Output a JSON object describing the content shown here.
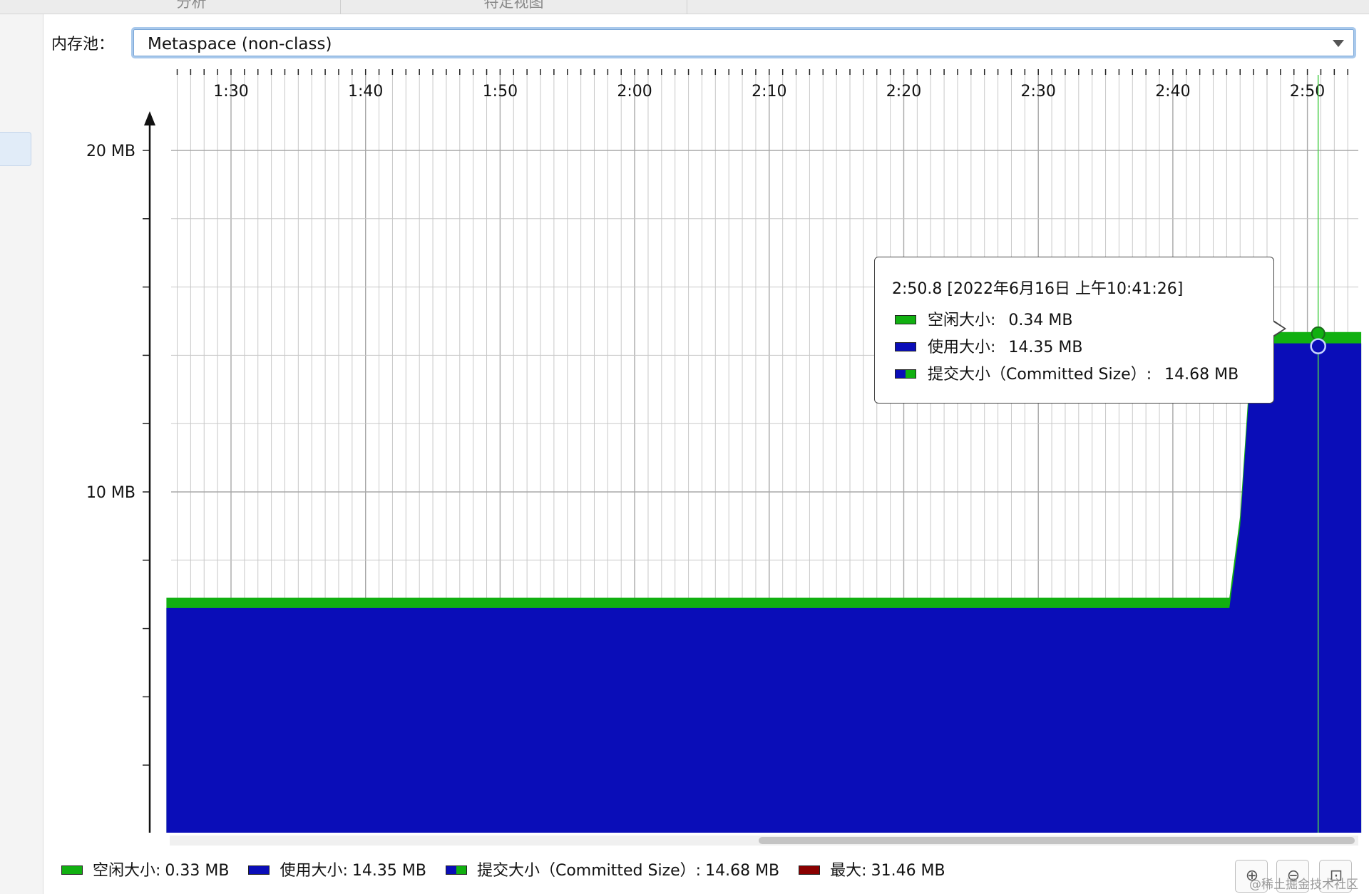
{
  "top_tabs": [
    "分析",
    "特定视图"
  ],
  "pool": {
    "label": "内存池：",
    "selected": "Metaspace (non-class)"
  },
  "colors": {
    "free": "#11b011",
    "used": "#0a0db8",
    "max": "#8a0000",
    "selection": "#a9c9ec"
  },
  "chart_data": {
    "type": "area",
    "x_ticks": [
      "1:30",
      "1:40",
      "1:50",
      "2:00",
      "2:10",
      "2:20",
      "2:30",
      "2:40",
      "2:50"
    ],
    "x_tick_minutes": [
      90,
      100,
      110,
      120,
      130,
      140,
      150,
      160,
      170
    ],
    "y_ticks": [
      "20 MB",
      "10 MB"
    ],
    "y_tick_values": [
      20,
      10
    ],
    "series": [
      {
        "name": "使用大小",
        "color": "#0a0db8",
        "points": [
          [
            85.2,
            6.6
          ],
          [
            164.2,
            6.6
          ],
          [
            165.0,
            9.0
          ],
          [
            165.6,
            12.5
          ],
          [
            166.0,
            14.1
          ],
          [
            166.6,
            14.35
          ],
          [
            170.8,
            14.35
          ],
          [
            174.0,
            14.35
          ]
        ]
      },
      {
        "name": "提交大小（Committed Size）",
        "color": "#11b011",
        "points": [
          [
            85.2,
            6.9
          ],
          [
            164.2,
            6.9
          ],
          [
            165.0,
            9.3
          ],
          [
            165.6,
            12.8
          ],
          [
            166.0,
            14.4
          ],
          [
            166.6,
            14.68
          ],
          [
            170.8,
            14.68
          ],
          [
            174.0,
            14.68
          ]
        ]
      }
    ],
    "crosshair_minute": 170.8,
    "grid": true
  },
  "tooltip": {
    "title": "2:50.8 [2022年6月16日 上午10:41:26]",
    "rows": [
      {
        "label": "空闲大小:",
        "value": "0.34 MB",
        "swatch": "green"
      },
      {
        "label": "使用大小:",
        "value": "14.35 MB",
        "swatch": "blue"
      },
      {
        "label": "提交大小（Committed Size）:",
        "value": "14.68 MB",
        "swatch": "split"
      }
    ]
  },
  "legend": [
    {
      "label": "空闲大小:",
      "value": "0.33 MB",
      "swatch": "green"
    },
    {
      "label": "使用大小:",
      "value": "14.35 MB",
      "swatch": "blue"
    },
    {
      "label": "提交大小（Committed Size）:",
      "value": "14.68 MB",
      "swatch": "split"
    },
    {
      "label": "最大:",
      "value": "31.46 MB",
      "swatch": "red"
    }
  ],
  "zoom_buttons": [
    {
      "icon": "zoom-in-icon",
      "glyph": "⊕"
    },
    {
      "icon": "zoom-out-icon",
      "glyph": "⊖"
    },
    {
      "icon": "fit-icon",
      "glyph": "⊡"
    }
  ],
  "watermark": "@稀土掘金技术社区"
}
